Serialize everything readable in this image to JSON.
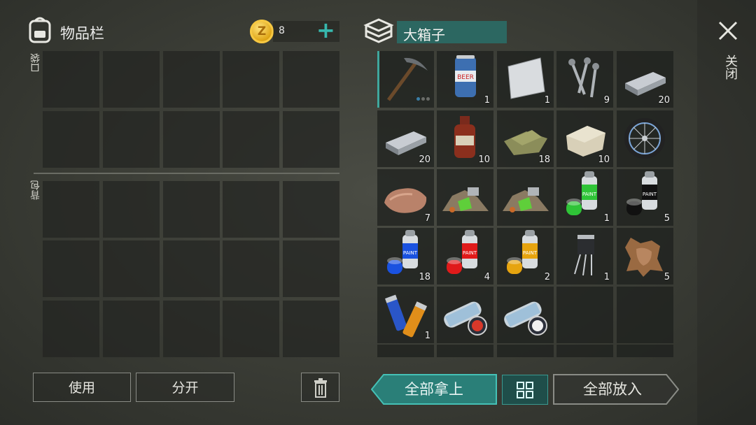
{
  "inventory": {
    "title": "物品栏",
    "coin_icon_letter": "Z",
    "coin_count": "8",
    "add_symbol": "+",
    "pocket_label": "口袋",
    "backpack_label": "背包",
    "use_button": "使用",
    "split_button": "分开"
  },
  "container": {
    "title": "大箱子",
    "take_all_button": "全部拿上",
    "put_all_button": "全部放入",
    "close_label": "关闭",
    "items": [
      {
        "name": "pickaxe",
        "count": ""
      },
      {
        "name": "beer-can",
        "count": "1"
      },
      {
        "name": "metal-sheet",
        "count": "1"
      },
      {
        "name": "nails",
        "count": "9"
      },
      {
        "name": "iron-ingot",
        "count": "20"
      },
      {
        "name": "iron-ingot",
        "count": "20"
      },
      {
        "name": "spirit-bottle",
        "count": "10"
      },
      {
        "name": "cloth-scrap",
        "count": "18"
      },
      {
        "name": "stone-block",
        "count": "10"
      },
      {
        "name": "bicycle-wheel",
        "count": ""
      },
      {
        "name": "copper-ore",
        "count": "7"
      },
      {
        "name": "scrap-pile",
        "count": ""
      },
      {
        "name": "scrap-pile",
        "count": ""
      },
      {
        "name": "green-spray-paint",
        "count": "1"
      },
      {
        "name": "black-spray-paint",
        "count": "5"
      },
      {
        "name": "blue-spray-paint",
        "count": "18"
      },
      {
        "name": "red-spray-paint",
        "count": "4"
      },
      {
        "name": "yellow-spray-paint",
        "count": "2"
      },
      {
        "name": "transistor",
        "count": "1"
      },
      {
        "name": "animal-hide",
        "count": "5"
      },
      {
        "name": "batteries",
        "count": "1"
      },
      {
        "name": "blueprint-scroll-a",
        "count": ""
      },
      {
        "name": "blueprint-scroll-b",
        "count": ""
      }
    ]
  },
  "colors": {
    "accent": "#37b7ad",
    "title_bg": "#2c6761"
  }
}
